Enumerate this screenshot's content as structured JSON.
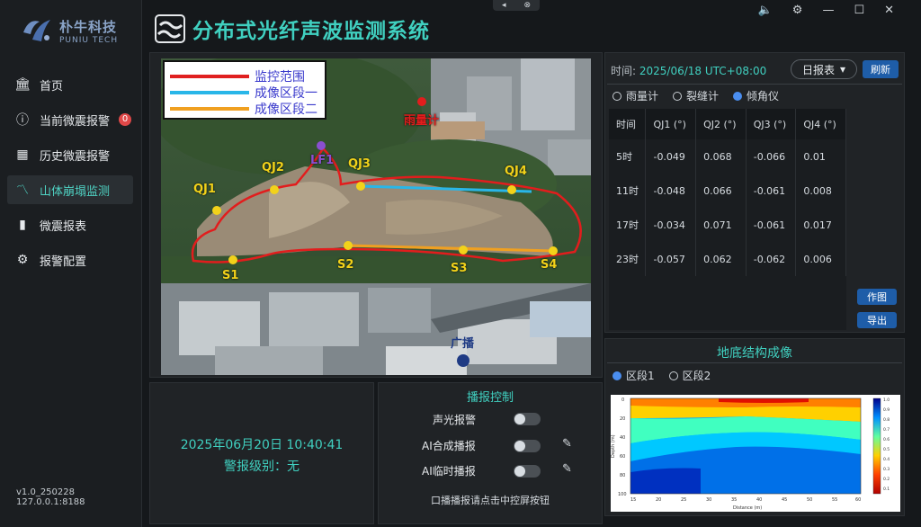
{
  "app": {
    "title": "分布式光纤声波监测系统",
    "logo_cn": "朴牛科技",
    "logo_en": "PUNIU TECH",
    "version": "v1.0_250228 127.0.0.1:8188"
  },
  "window_controls": {
    "volume_icon": "speaker-icon",
    "settings_icon": "gear-icon",
    "minimize": "—",
    "maximize": "☐",
    "close": "✕"
  },
  "sidebar": {
    "items": [
      {
        "label": "首页",
        "icon": "bank-icon"
      },
      {
        "label": "当前微震报警",
        "icon": "info-icon",
        "badge": "0"
      },
      {
        "label": "历史微震报警",
        "icon": "calendar-icon"
      },
      {
        "label": "山体崩塌监测",
        "icon": "chart-search-icon",
        "active": true
      },
      {
        "label": "微震报表",
        "icon": "bar-chart-icon"
      },
      {
        "label": "报警配置",
        "icon": "gear-icon"
      }
    ]
  },
  "map": {
    "legend": [
      {
        "label": "监控范围",
        "color": "#e02020"
      },
      {
        "label": "成像区段一",
        "color": "#29b6e8"
      },
      {
        "label": "成像区段二",
        "color": "#f0a020"
      }
    ],
    "labels": {
      "rain": "雨量计",
      "lf1": "LF1",
      "qj1": "QJ1",
      "qj2": "QJ2",
      "qj3": "QJ3",
      "qj4": "QJ4",
      "s1": "S1",
      "s2": "S2",
      "s3": "S3",
      "s4": "S4",
      "broadcast": "广播"
    }
  },
  "report": {
    "time_label": "时间:",
    "time_value": "2025/06/18 UTC+08:00",
    "period": "日报表",
    "refresh": "刷新",
    "radios": [
      {
        "label": "雨量计",
        "on": false
      },
      {
        "label": "裂缝计",
        "on": false
      },
      {
        "label": "倾角仪",
        "on": true
      }
    ],
    "headers": [
      "时间",
      "QJ1 (°)",
      "QJ2 (°)",
      "QJ3 (°)",
      "QJ4 (°)"
    ],
    "rows": [
      [
        "5时",
        "-0.049",
        "0.068",
        "-0.066",
        "0.01"
      ],
      [
        "11时",
        "-0.048",
        "0.066",
        "-0.061",
        "0.008"
      ],
      [
        "17时",
        "-0.034",
        "0.071",
        "-0.061",
        "0.017"
      ],
      [
        "23时",
        "-0.057",
        "0.062",
        "-0.062",
        "0.006"
      ]
    ],
    "plot_btn": "作图",
    "export_btn": "导出"
  },
  "imaging": {
    "title": "地底结构成像",
    "radios": [
      {
        "label": "区段1",
        "on": true
      },
      {
        "label": "区段2",
        "on": false
      }
    ],
    "x_ticks": [
      "15",
      "20",
      "25",
      "30",
      "35",
      "40",
      "45",
      "50",
      "55",
      "60"
    ],
    "y_ticks": [
      "0",
      "20",
      "40",
      "60",
      "80",
      "100"
    ],
    "cbar_ticks": [
      "1.0",
      "0.9",
      "0.8",
      "0.7",
      "0.6",
      "0.5",
      "0.4",
      "0.3",
      "0.2",
      "0.1"
    ],
    "xlabel": "Distance (m)",
    "ylabel": "Depth (m)"
  },
  "status": {
    "datetime": "2025年06月20日 10:40:41",
    "level": "警报级别：无"
  },
  "broadcast": {
    "title": "播报控制",
    "rows": [
      {
        "label": "声光报警",
        "on": false
      },
      {
        "label": "AI合成播报",
        "on": false
      },
      {
        "label": "AI临时播报",
        "on": false
      }
    ],
    "hint": "口播播报请点击中控屏按钮"
  }
}
